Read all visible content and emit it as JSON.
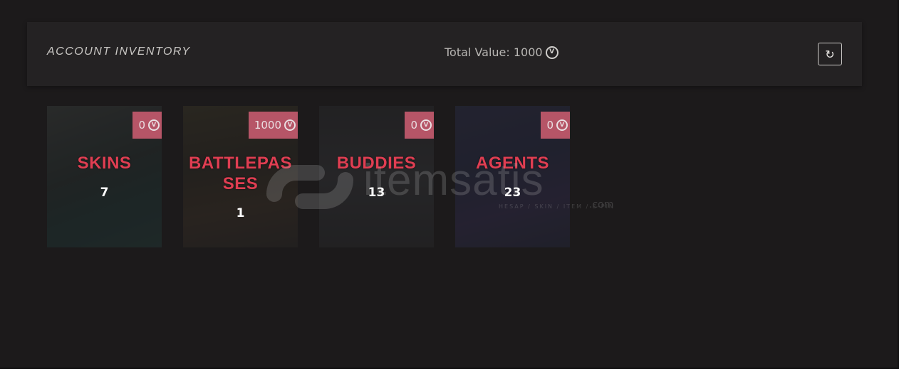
{
  "header": {
    "title": "ACCOUNT INVENTORY",
    "total_label": "Total Value: 1000",
    "currency_icon": "valorant-points-icon",
    "refresh_icon": "refresh-icon"
  },
  "cards": [
    {
      "category": "SKINS",
      "badge_value": "0",
      "count": "7"
    },
    {
      "category": "BATTLEPASSES",
      "badge_value": "1000",
      "count": "1"
    },
    {
      "category": "BUDDIES",
      "badge_value": "0",
      "count": "13"
    },
    {
      "category": "AGENTS",
      "badge_value": "0",
      "count": "23"
    }
  ],
  "watermark": {
    "brand": "itemsatis",
    "tagline": "HESAP / SKIN / ITEM / E-PIN",
    "suffix": ".com"
  },
  "colors": {
    "background": "#1c1a1b",
    "header_bg": "#242223",
    "category_text": "#e03e52",
    "badge_bg": "#b65567"
  }
}
